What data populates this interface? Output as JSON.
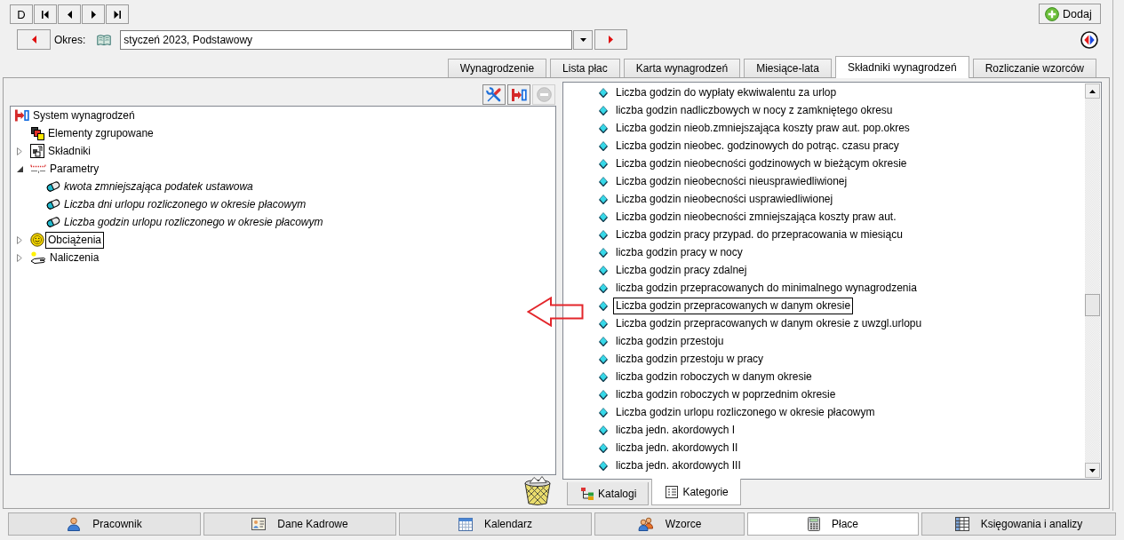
{
  "toolbar": {
    "nav_buttons": [
      {
        "kind": "label",
        "label": "D"
      },
      {
        "kind": "first"
      },
      {
        "kind": "previous"
      },
      {
        "kind": "next"
      },
      {
        "kind": "last"
      }
    ],
    "add_button": {
      "label": "Dodaj"
    }
  },
  "period": {
    "label": "Okres:",
    "value": "styczeń 2023, Podstawowy"
  },
  "tabs": [
    {
      "label": "Wynagrodzenie",
      "selected": false
    },
    {
      "label": "Lista płac",
      "selected": false
    },
    {
      "label": "Karta wynagrodzeń",
      "selected": false
    },
    {
      "label": "Miesiące-lata",
      "selected": false
    },
    {
      "label": "Składniki wynagrodzeń",
      "selected": true
    },
    {
      "label": "Rozliczanie wzorców",
      "selected": false
    }
  ],
  "left_panel": {
    "tools": [
      {
        "kind": "tools",
        "disabled": false
      },
      {
        "kind": "system",
        "disabled": false
      },
      {
        "kind": "remove",
        "disabled": true
      }
    ],
    "tree": [
      {
        "label": "System wynagrodzeń",
        "kind": "root",
        "selected": false,
        "children": [
          {
            "label": "Elementy zgrupowane",
            "kind": "group",
            "selected": false
          },
          {
            "label": "Składniki",
            "kind": "components",
            "selected": false,
            "expanded": false
          },
          {
            "label": "Parametry",
            "kind": "parameters",
            "selected": false,
            "expanded": true,
            "children": [
              {
                "label": "kwota zmniejszająca podatek ustawowa",
                "kind": "parameter",
                "selected": false
              },
              {
                "label": "Liczba dni urlopu rozliczonego w okresie płacowym",
                "kind": "parameter",
                "selected": false
              },
              {
                "label": "Liczba godzin urlopu rozliczonego w okresie płacowym",
                "kind": "parameter",
                "selected": false
              }
            ]
          },
          {
            "label": "Obciążenia",
            "kind": "charges",
            "selected": true,
            "expanded": false
          },
          {
            "label": "Naliczenia",
            "kind": "accruals",
            "selected": false,
            "expanded": false
          }
        ]
      }
    ]
  },
  "right_panel": {
    "items": [
      {
        "label": "Liczba godzin do wypłaty ekwiwalentu za urlop",
        "selected": false
      },
      {
        "label": "liczba godzin nadliczbowych w nocy z zamkniętego okresu",
        "selected": false
      },
      {
        "label": "Liczba godzin nieob.zmniejszająca koszty praw aut. pop.okres",
        "selected": false
      },
      {
        "label": "Liczba godzin nieobec. godzinowych do potrąc. czasu pracy",
        "selected": false
      },
      {
        "label": "Liczba godzin nieobecności godzinowych w bieżącym okresie",
        "selected": false
      },
      {
        "label": "Liczba godzin nieobecności nieusprawiedliwionej",
        "selected": false
      },
      {
        "label": "Liczba godzin nieobecności usprawiedliwionej",
        "selected": false
      },
      {
        "label": "Liczba godzin nieobecności zmniejszająca koszty praw aut.",
        "selected": false
      },
      {
        "label": "Liczba godzin pracy przypad. do przepracowania w miesiącu",
        "selected": false
      },
      {
        "label": "liczba godzin pracy w nocy",
        "selected": false
      },
      {
        "label": "Liczba godzin pracy zdalnej",
        "selected": false
      },
      {
        "label": "liczba godzin przepracowanych do minimalnego wynagrodzenia",
        "selected": false
      },
      {
        "label": "Liczba godzin przepracowanych w danym okresie",
        "selected": true
      },
      {
        "label": "Liczba godzin przepracowanych w danym okresie z uwzgl.urlopu",
        "selected": false
      },
      {
        "label": "liczba godzin przestoju",
        "selected": false
      },
      {
        "label": "liczba godzin przestoju w pracy",
        "selected": false
      },
      {
        "label": "liczba godzin roboczych w danym okresie",
        "selected": false
      },
      {
        "label": "liczba godzin roboczych w poprzednim okresie",
        "selected": false
      },
      {
        "label": "Liczba godzin urlopu rozliczonego w okresie płacowym",
        "selected": false
      },
      {
        "label": "liczba jedn. akordowych I",
        "selected": false
      },
      {
        "label": "liczba jedn. akordowych II",
        "selected": false
      },
      {
        "label": "liczba jedn. akordowych III",
        "selected": false
      }
    ],
    "tabs": [
      {
        "label": "Katalogi",
        "kind": "catalogs",
        "selected": false
      },
      {
        "label": "Kategorie",
        "kind": "categories",
        "selected": true
      }
    ]
  },
  "bottom_tabs": [
    {
      "label": "Pracownik",
      "kind": "employee",
      "selected": false
    },
    {
      "label": "Dane Kadrowe",
      "kind": "personnel",
      "selected": false
    },
    {
      "label": "Kalendarz",
      "kind": "calendar",
      "selected": false
    },
    {
      "label": "Wzorce",
      "kind": "templates",
      "selected": false
    },
    {
      "label": "Płace",
      "kind": "payroll",
      "selected": true
    },
    {
      "label": "Księgowania i analizy",
      "kind": "accounting",
      "selected": false
    }
  ]
}
